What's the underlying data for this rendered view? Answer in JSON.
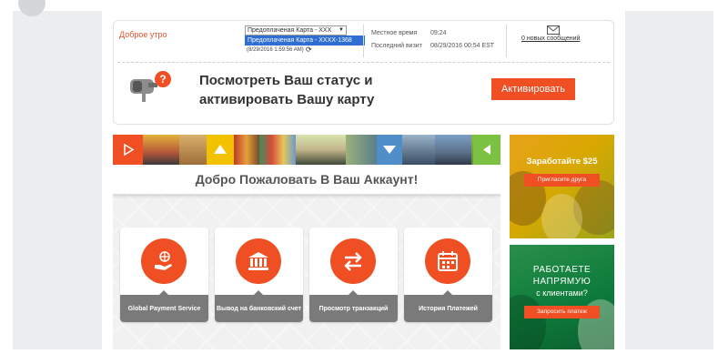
{
  "header": {
    "greeting": "Доброе утро",
    "card_select_value": "Предоплаченая Карта - ХХХ",
    "card_option_highlighted": "Предоплаченая Карта - ХХХХ-1368",
    "card_timestamp": "(8/29/2016 1:59:56 AM)",
    "local_time_label": "Местное время",
    "local_time_value": "09:24",
    "last_visit_label": "Последний визит",
    "last_visit_value": "08/29/2016 00:54 EST",
    "messages_link": "0 новых сообщений"
  },
  "status": {
    "text": "Посмотреть Ваш статус и активировать Вашу карту",
    "activate_button": "Активировать",
    "accent_color": "#f04e23"
  },
  "banner": {
    "welcome": "Добро Пожаловать В Ваш Аккаунт!"
  },
  "tiles": [
    {
      "label": "Global Payment Service",
      "icon": "globe-hand-icon"
    },
    {
      "label": "Вывод на банковский счет",
      "icon": "bank-icon"
    },
    {
      "label": "Просмотр транзакций",
      "icon": "transfer-arrows-icon"
    },
    {
      "label": "История Платежей",
      "icon": "calendar-icon"
    }
  ],
  "promos": {
    "earn_title": "Заработайте $25",
    "earn_button": "Пригласите друга",
    "work_title_line1": "РАБОТАЕТЕ",
    "work_title_line2": "НАПРЯМУЮ",
    "work_title_line3": "с клиентами?",
    "work_button": "Запросить платеж"
  }
}
